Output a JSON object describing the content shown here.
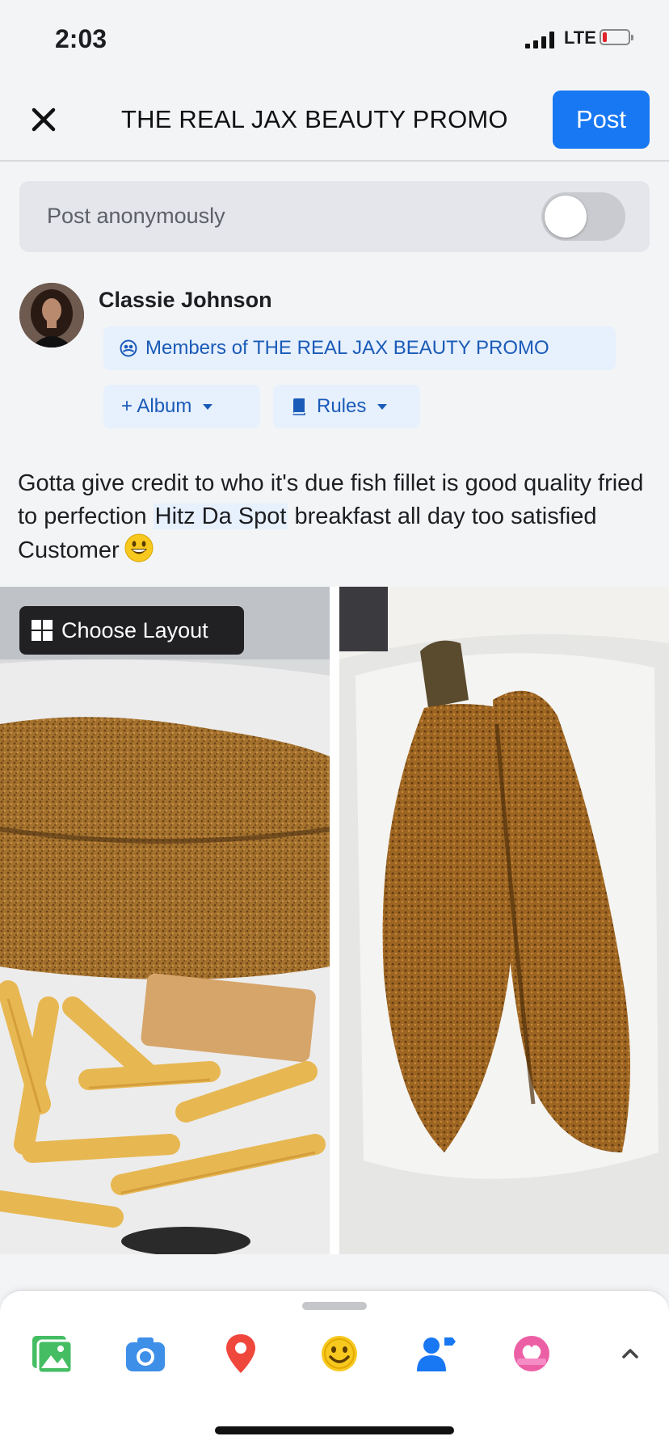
{
  "status_bar": {
    "time": "2:03",
    "carrier": "LTE"
  },
  "header": {
    "title": "THE REAL JAX BEAUTY PROMO",
    "post_label": "Post"
  },
  "anonymous": {
    "label": "Post anonymously",
    "enabled": false
  },
  "author": {
    "name": "Classie Johnson"
  },
  "audience": {
    "label": "Members of THE REAL JAX BEAUTY PROMO"
  },
  "album": {
    "label": "+ Album"
  },
  "rules": {
    "label": "Rules"
  },
  "post": {
    "text_before": "Gotta give credit to who it's due fish fillet is good quality fried to perfection ",
    "tag": "Hitz Da Spot",
    "text_after": " breakfast all day too satisfied Customer"
  },
  "photos": {
    "choose_layout_label": "Choose Layout"
  },
  "toolbar": {
    "icons": [
      "photo-icon",
      "camera-icon",
      "location-icon",
      "emoji-icon",
      "tag-people-icon",
      "sticker-icon",
      "chevron-up-icon"
    ]
  },
  "colors": {
    "accent": "#1877f2",
    "chip_bg": "#e7f0fd",
    "chip_text": "#1a5bb8"
  }
}
